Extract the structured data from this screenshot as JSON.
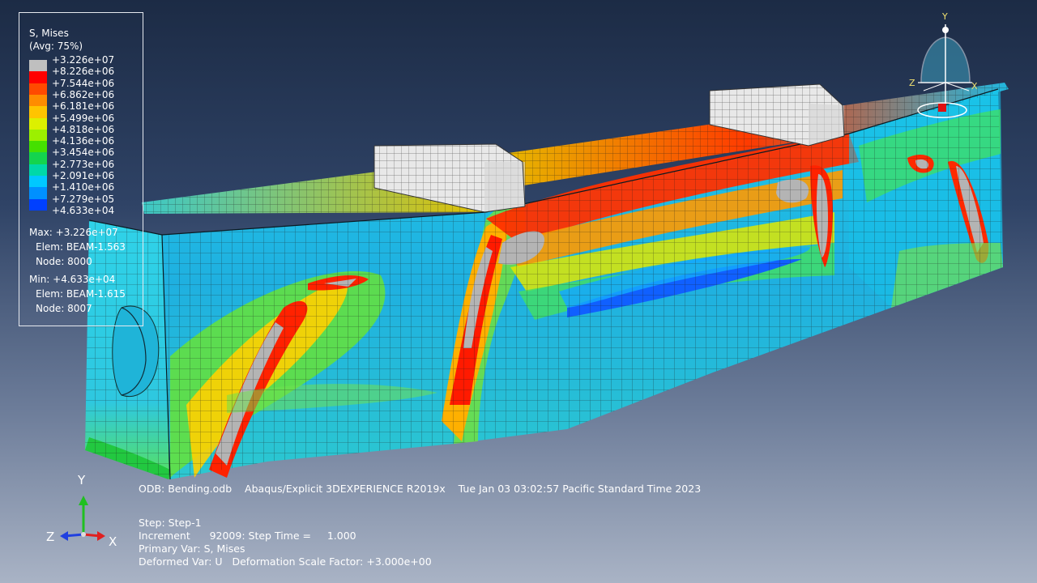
{
  "legend": {
    "title": "S, Mises",
    "subtitle": "(Avg: 75%)",
    "ticks": [
      "+3.226e+07",
      "+8.226e+06",
      "+7.544e+06",
      "+6.862e+06",
      "+6.181e+06",
      "+5.499e+06",
      "+4.818e+06",
      "+4.136e+06",
      "+3.454e+06",
      "+2.773e+06",
      "+2.091e+06",
      "+1.410e+06",
      "+7.279e+05",
      "+4.633e+04"
    ],
    "colors": [
      "#bfbfbf",
      "#ff0000",
      "#ff4a00",
      "#ff8c00",
      "#ffc400",
      "#dcf000",
      "#9cf000",
      "#45e000",
      "#14d44e",
      "#00d8a8",
      "#00c8ff",
      "#0090ff",
      "#0040ff"
    ],
    "max_label": "Max: +3.226e+07",
    "max_elem": "Elem: BEAM-1.563",
    "max_node": "Node: 8000",
    "min_label": "Min: +4.633e+04",
    "min_elem": "Elem: BEAM-1.615",
    "min_node": "Node: 8007"
  },
  "footer": {
    "odb": "ODB: Bending.odb    Abaqus/Explicit 3DEXPERIENCE R2019x    Tue Jan 03 03:02:57 Pacific Standard Time 2023",
    "step": "Step: Step-1",
    "increment": "Increment      92009: Step Time =     1.000",
    "primary": "Primary Var: S, Mises",
    "deformed": "Deformed Var: U   Deformation Scale Factor: +3.000e+00"
  },
  "triad": {
    "y": "Y",
    "z": "Z",
    "x": "X"
  },
  "view_cube": {
    "y": "Y",
    "z": "Z",
    "x": "X"
  },
  "colors": {
    "background_top": "#1c2b45",
    "background_bottom": "#a9b3c5"
  }
}
